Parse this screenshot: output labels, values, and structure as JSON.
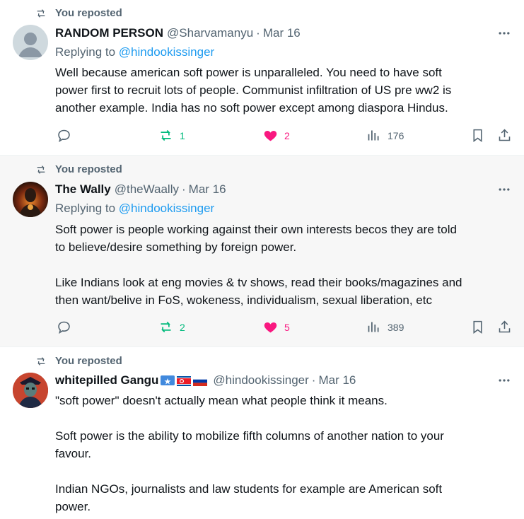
{
  "posts": [
    {
      "repost_label": "You reposted",
      "name": "RANDOM PERSON",
      "handle": "@Sharvamanyu",
      "separator": "·",
      "date": "Mar 16",
      "replying_prefix": "Replying to",
      "replying_handle": "@hindookissinger",
      "text": "Well because american soft power is unparalleled. You need to have soft\npower first to recruit lots of people. Communist infiltration of US pre ww2 is\nanother example. India has no soft power except among diaspora Hindus.",
      "reposts": "1",
      "likes": "2",
      "views": "176"
    },
    {
      "repost_label": "You reposted",
      "name": "The Wally",
      "handle": "@theWaally",
      "separator": "·",
      "date": "Mar 16",
      "replying_prefix": "Replying to",
      "replying_handle": "@hindookissinger",
      "text": "Soft power is people working against their own interests becos they are told\nto believe/desire something by foreign power.\n\nLike Indians look at eng movies & tv shows, read their books/magazines and\nthen want/belive in FoS, wokeness, individualism, sexual liberation, etc",
      "reposts": "2",
      "likes": "5",
      "views": "389"
    },
    {
      "repost_label": "You reposted",
      "name": "whitepilled Gangu",
      "handle": "@hindookissinger",
      "separator": "·",
      "date": "Mar 16",
      "text": "\"soft power\" doesn't actually mean what people think it means.\n\nSoft power is the ability to mobilize fifth columns of another nation to your\nfavour.\n\nIndian NGOs, journalists and law students for example are American soft\npower."
    }
  ],
  "colors": {
    "repost_green": "#00ba7c",
    "like_pink": "#f91880",
    "link_blue": "#1d9bf0",
    "muted": "#536471"
  },
  "icons": [
    "repost-icon",
    "more-icon",
    "reply-icon",
    "like-icon",
    "views-icon",
    "bookmark-icon",
    "share-icon"
  ]
}
